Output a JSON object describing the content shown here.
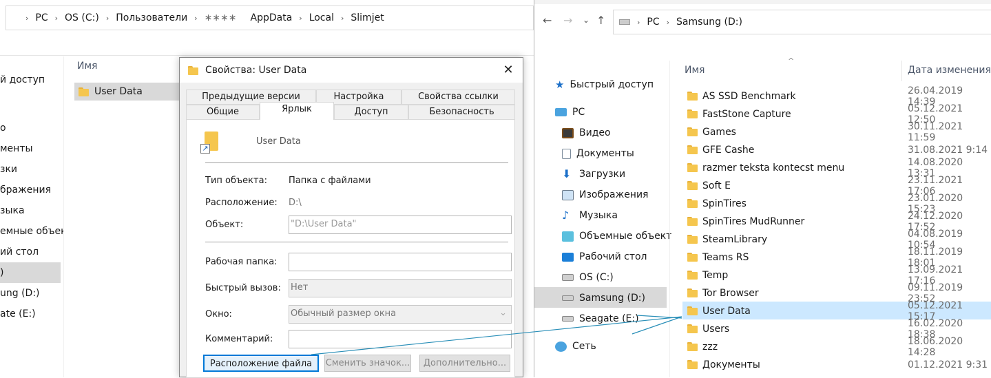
{
  "left_window": {
    "breadcrumb": [
      "PC",
      "OS (C:)",
      "Пользователи",
      "∗∗∗∗",
      "AppData",
      "Local",
      "Slimjet"
    ],
    "nav_items": [
      "й доступ",
      "",
      "о",
      "менты",
      "зки",
      "бражения",
      "зыка",
      "емные объект",
      "ий стол",
      ")",
      "ung (D:)",
      "ate (E:)"
    ],
    "column_name": "Имя",
    "file": "User Data"
  },
  "dialog": {
    "title": "Свойства: User Data",
    "tabs_row1": [
      "Предыдущие версии",
      "Настройка",
      "Свойства ссылки"
    ],
    "tabs_row2": [
      "Общие",
      "Ярлык",
      "Доступ",
      "Безопасность"
    ],
    "item_name": "User Data",
    "labels": {
      "type": "Тип объекта:",
      "location": "Расположение:",
      "target": "Объект:",
      "workdir": "Рабочая папка:",
      "hotkey": "Быстрый вызов:",
      "window": "Окно:",
      "comment": "Комментарий:"
    },
    "values": {
      "type": "Папка с файлами",
      "location": "D:\\",
      "target": "\"D:\\User Data\"",
      "workdir": "",
      "hotkey": "Нет",
      "window": "Обычный размер окна",
      "comment": ""
    },
    "buttons": {
      "open_location": "Расположение файла",
      "change_icon": "Сменить значок...",
      "advanced": "Дополнительно..."
    },
    "close_glyph": "✕"
  },
  "right_window": {
    "breadcrumb": [
      "PC",
      "Samsung (D:)"
    ],
    "nav": {
      "back": "←",
      "forward": "→",
      "recent": "⌄",
      "up": "↑"
    },
    "nav_items": [
      {
        "label": "Быстрый доступ",
        "icon": "star-icon"
      },
      {
        "label": "PC",
        "icon": "computer-icon"
      },
      {
        "label": "Видео",
        "icon": "video-icon"
      },
      {
        "label": "Документы",
        "icon": "document-icon"
      },
      {
        "label": "Загрузки",
        "icon": "download-icon"
      },
      {
        "label": "Изображения",
        "icon": "image-icon"
      },
      {
        "label": "Музыка",
        "icon": "music-icon"
      },
      {
        "label": "Объемные объект",
        "icon": "cube-icon"
      },
      {
        "label": "Рабочий стол",
        "icon": "desktop-icon"
      },
      {
        "label": "OS (C:)",
        "icon": "drive-icon"
      },
      {
        "label": "Samsung (D:)",
        "icon": "drive-icon"
      },
      {
        "label": "Seagate (E:)",
        "icon": "drive-icon"
      },
      {
        "label": "Сеть",
        "icon": "network-icon"
      }
    ],
    "columns": {
      "name": "Имя",
      "date": "Дата изменения"
    },
    "files": [
      {
        "name": "AS SSD Benchmark",
        "date": "26.04.2019 14:39"
      },
      {
        "name": "FastStone Capture",
        "date": "05.12.2021 12:50"
      },
      {
        "name": "Games",
        "date": "30.11.2021 11:59"
      },
      {
        "name": "GFE Cashe",
        "date": "31.08.2021 9:14"
      },
      {
        "name": "razmer teksta kontecst menu",
        "date": "14.08.2020 13:31"
      },
      {
        "name": "Soft E",
        "date": "23.11.2021 17:06"
      },
      {
        "name": "SpinTires",
        "date": "23.01.2020 15:23"
      },
      {
        "name": "SpinTires MudRunner",
        "date": "24.12.2020 17:52"
      },
      {
        "name": "SteamLibrary",
        "date": "04.08.2019 10:54"
      },
      {
        "name": "Teams RS",
        "date": "18.11.2019 18:01"
      },
      {
        "name": "Temp",
        "date": "13.09.2021 17:16"
      },
      {
        "name": "Tor Browser",
        "date": "09.11.2019 23:52"
      },
      {
        "name": "User Data",
        "date": "05.12.2021 15:17"
      },
      {
        "name": "Users",
        "date": "16.02.2020 18:38"
      },
      {
        "name": "zzz",
        "date": "18.06.2020 14:28"
      },
      {
        "name": "Документы",
        "date": "01.12.2021 9:31"
      }
    ]
  },
  "colors": {
    "selection": "#cce8ff",
    "folder": "#f5c64e",
    "arrow": "#2a8fb8"
  }
}
